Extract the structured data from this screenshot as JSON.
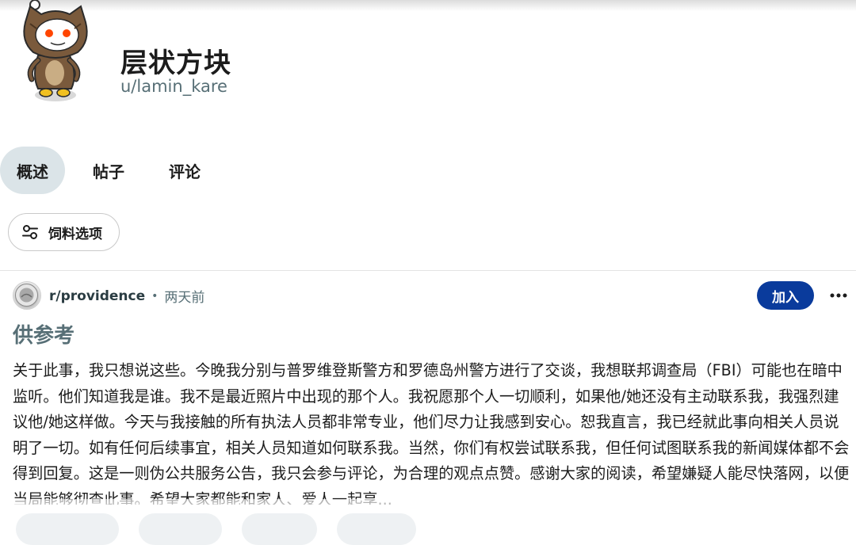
{
  "profile": {
    "display_name": "层状方块",
    "username": "u/lamin_kare",
    "avatar_icon": "snoo-owl-costume-avatar"
  },
  "tabs": [
    {
      "label": "概述",
      "active": true
    },
    {
      "label": "帖子",
      "active": false
    },
    {
      "label": "评论",
      "active": false
    }
  ],
  "feed_options": {
    "label": "饲料选项",
    "icon": "sliders-icon"
  },
  "post": {
    "subreddit": "r/providence",
    "time": "两天前",
    "join_label": "加入",
    "more_icon": "more-horizontal-icon",
    "title": "供参考",
    "body": "关于此事，我只想说这些。今晚我分别与普罗维登斯警方和罗德岛州警方进行了交谈，我想联邦调查局（FBI）可能也在暗中监听。他们知道我是谁。我不是最近照片中出现的那个人。我祝愿那个人一切顺利，如果他/她还没有主动联系我，我强烈建议他/她这样做。今天与我接触的所有执法人员都非常专业，他们尽力让我感到安心。恕我直言，我已经就此事向相关人员说明了一切。如有任何后续事宜，相关人员知道如何联系我。当然，你们有权尝试联系我，但任何试图联系我的新闻媒体都不会得到回复。这是一则伪公共服务公告，我只会参与评论，为合理的观点点赞。感谢大家的阅读，希望嫌疑人能尽快落网，以便当局能够彻查此事。希望大家都能和家人、爱人一起享..."
  },
  "colors": {
    "accent_join": "#0a3b9c",
    "active_tab_bg": "#dbe4e8",
    "muted_text": "#576f76"
  }
}
